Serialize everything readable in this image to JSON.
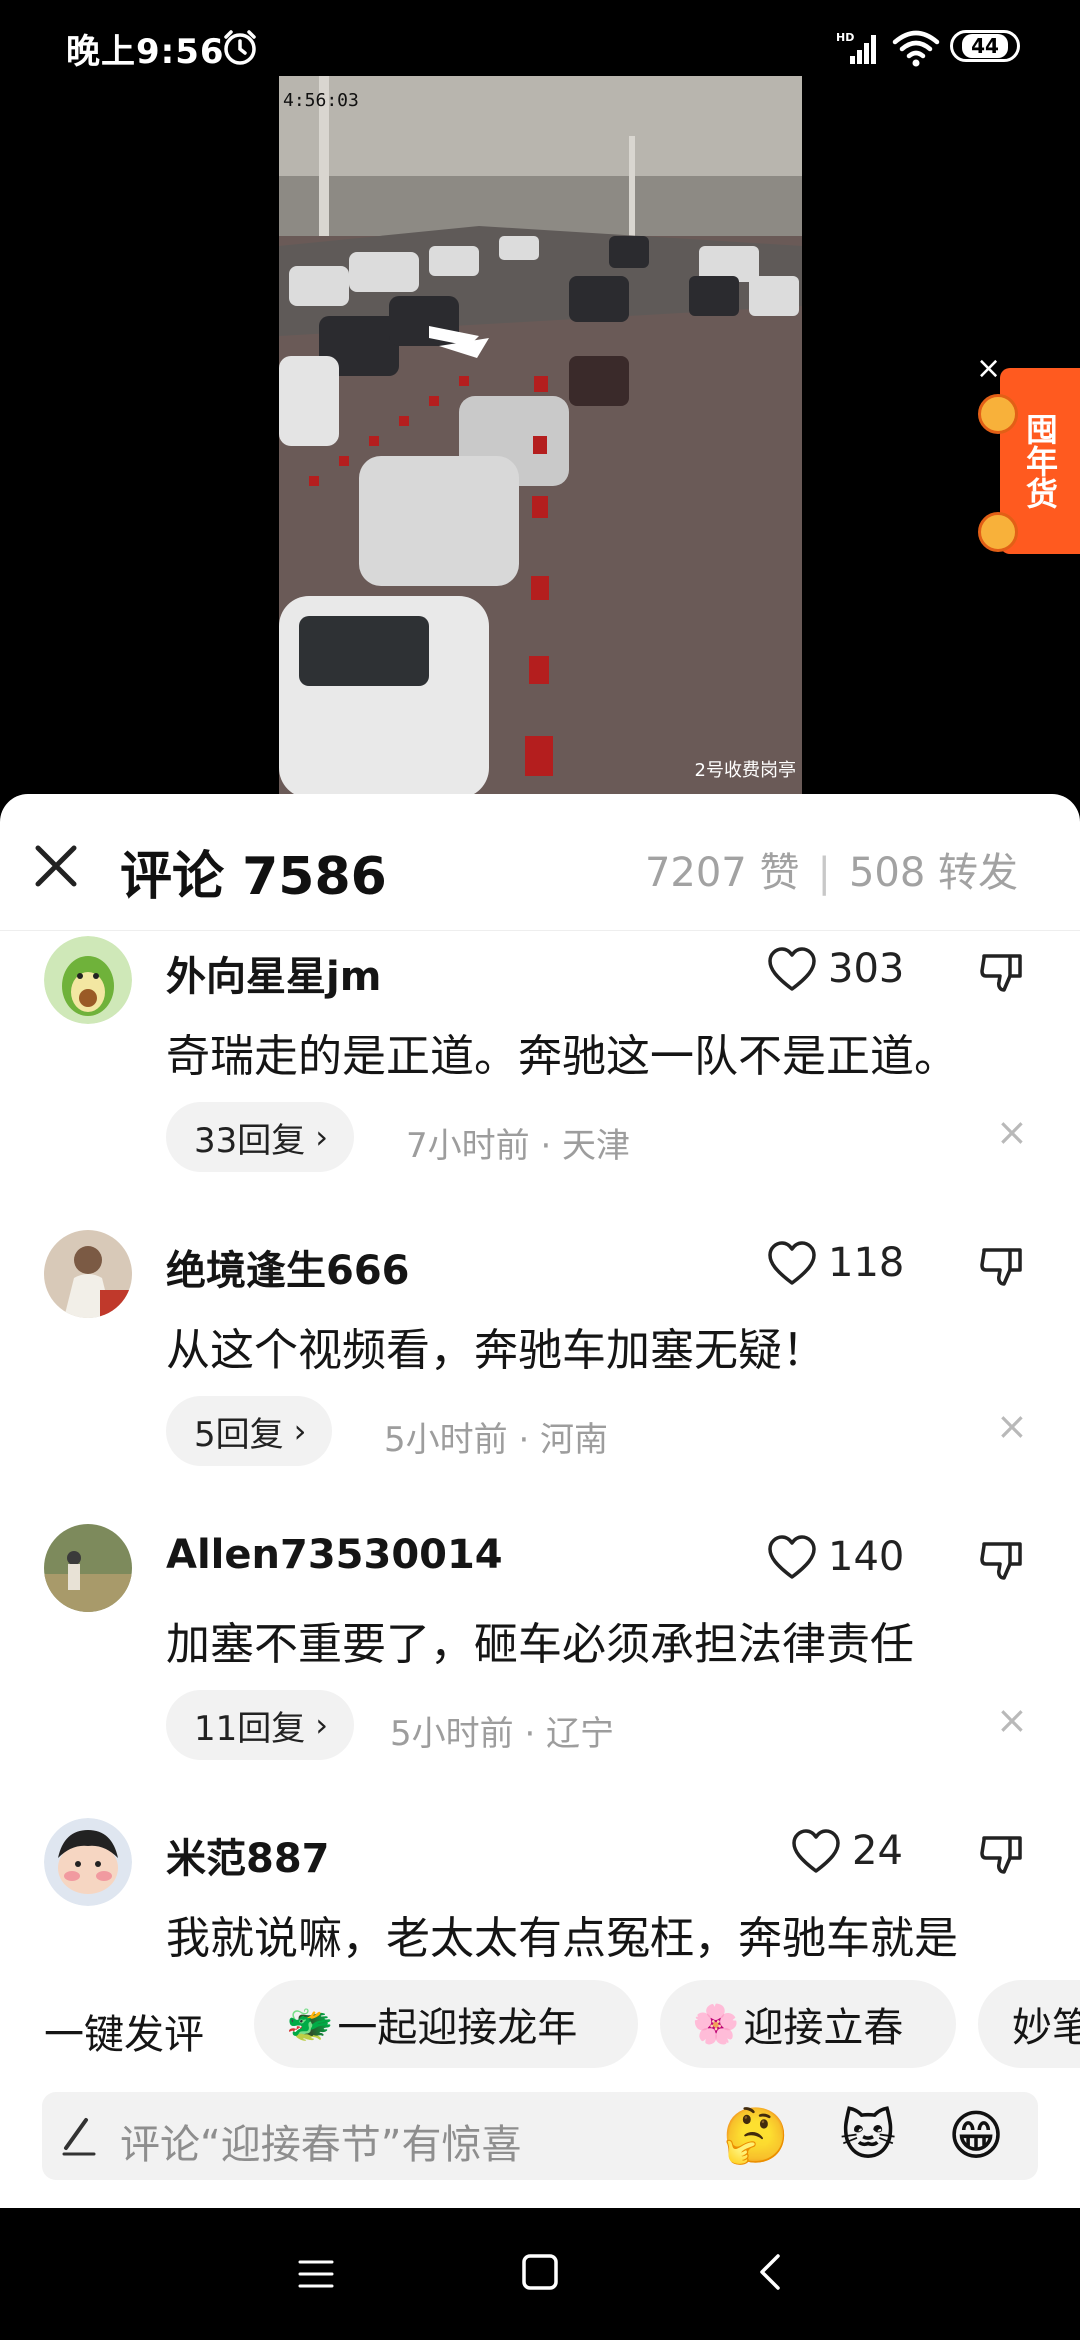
{
  "status_bar": {
    "time": "晚上9:56",
    "network": "HD",
    "battery": "44"
  },
  "video": {
    "timestamp": "4:56:03",
    "caption": "2号收费岗亭"
  },
  "promo": {
    "label": "囤年货"
  },
  "comments_panel": {
    "title": "评论 7586",
    "likes": "7207 赞",
    "shares": "508 转发",
    "comments": [
      {
        "username": "外向星星jm",
        "text": "奇瑞走的是正道。奔驰这一队不是正道。",
        "likes": "303",
        "replies": "33回复",
        "meta": "7小时前 · 天津"
      },
      {
        "username": "绝境逢生666",
        "text": "从这个视频看，奔驰车加塞无疑！",
        "likes": "118",
        "replies": "5回复",
        "meta": "5小时前 · 河南"
      },
      {
        "username": "Allen73530014",
        "text": "加塞不重要了，砸车必须承担法律责任",
        "likes": "140",
        "replies": "11回复",
        "meta": "5小时前 · 辽宁"
      },
      {
        "username": "米范887",
        "text": "我就说嘛，老太太有点冤枉，奔驰车就是",
        "likes": "24"
      }
    ]
  },
  "quick_comments": {
    "label": "一键发评",
    "chips": [
      {
        "emoji": "🐲",
        "text": "一起迎接龙年"
      },
      {
        "emoji": "🌸",
        "text": "迎接立春"
      },
      {
        "text": "妙笔"
      }
    ]
  },
  "input": {
    "placeholder": "评论“迎接春节”有惊喜",
    "emojis": [
      "🤔",
      "🐱",
      "😁"
    ]
  }
}
